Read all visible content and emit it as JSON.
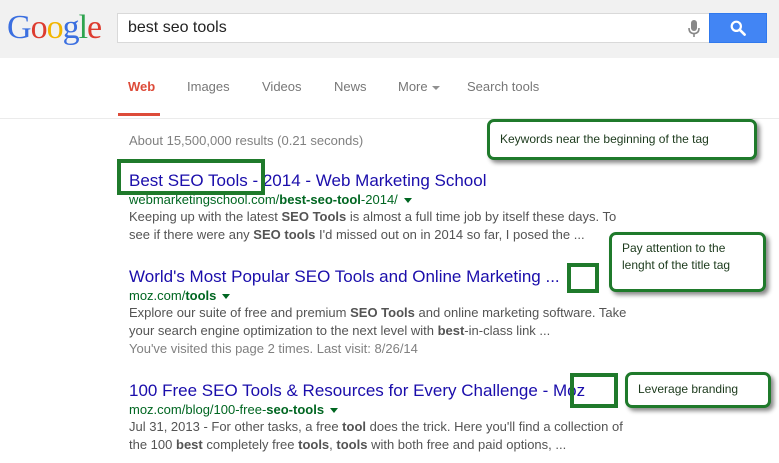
{
  "logo": {
    "letters": [
      "G",
      "o",
      "o",
      "g",
      "l",
      "e"
    ]
  },
  "search": {
    "query": "best seo tools"
  },
  "tabs": {
    "web": "Web",
    "images": "Images",
    "videos": "Videos",
    "news": "News",
    "more": "More",
    "search_tools": "Search tools"
  },
  "stats": "About 15,500,000 results (0.21 seconds)",
  "results": [
    {
      "title_a": "Best SEO Tools",
      "title_b": " - 2014 - Web Marketing School",
      "url_a": "webmarketingschool.com/",
      "url_b": "best-seo-tool",
      "url_c": "-2014/",
      "s1_a": "Keeping up with the latest ",
      "s1_b": "SEO Tools",
      "s1_c": " is almost a full time job by itself these days. To",
      "s2_a": "see if there were any ",
      "s2_b": "SEO tools",
      "s2_c": " I'd missed out on in 2014 so far, I posed the ..."
    },
    {
      "title_a": "World's Most Popular SEO Tools and Online Marketing ",
      "title_b": "...",
      "url_a": "moz.com/",
      "url_b": "tools",
      "s1_a": "Explore our suite of free and premium ",
      "s1_b": "SEO Tools",
      "s1_c": " and online marketing software. Take",
      "s2_a": "your search engine optimization to the next level with ",
      "s2_b": "best",
      "s2_c": "-in-class link ...",
      "visited": "You've visited this page 2 times. Last visit: 8/26/14"
    },
    {
      "title_a": "100 Free SEO Tools & Resources for Every Challenge ",
      "title_b": "- Moz",
      "url_a": "moz.com/blog/100-free-",
      "url_b": "seo-tools",
      "s1_a": "Jul 31, 2013 - For other tasks, a free ",
      "s1_b": "tool",
      "s1_c": " does the trick. Here you'll find a collection of",
      "s2_a": "the 100 ",
      "s2_b": "best",
      "s2_c": " completely free ",
      "s2_d": "tools",
      "s2_e": ", ",
      "s2_f": "tools",
      "s2_g": " with both free and paid options, ..."
    }
  ],
  "callouts": {
    "keywords": "Keywords near the beginning of the tag",
    "length": "Pay attention to the lenght of the title tag",
    "branding": "Leverage branding"
  },
  "colors": {
    "accent": "#1f7a2b",
    "link": "#1a0dab",
    "url": "#006621",
    "tab_active": "#dd4b39",
    "search_button": "#4285f4"
  },
  "icons": [
    "microphone-icon",
    "magnifier-icon",
    "dropdown-caret-icon"
  ]
}
